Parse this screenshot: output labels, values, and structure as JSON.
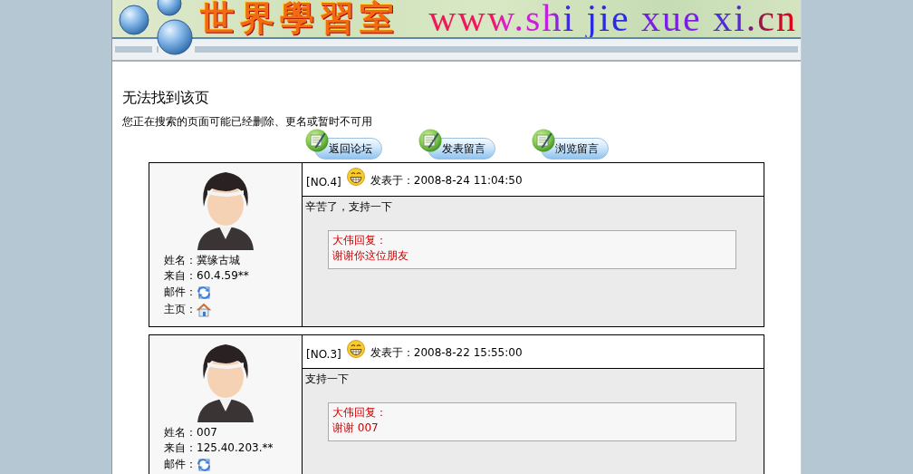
{
  "banner": {
    "title": "世界學習室",
    "url": "www.shi jie xue xi.cn"
  },
  "error": {
    "heading": "无法找到该页",
    "message": "您正在搜索的页面可能已经删除、更名或暂时不可用"
  },
  "buttons": [
    "返回论坛",
    "发表留言",
    "浏览留言"
  ],
  "posts": [
    {
      "number": "[NO.4]",
      "posted": "发表于：2008-8-24 11:04:50",
      "content": "辛苦了，支持一下",
      "reply": {
        "title": "大伟回复：",
        "text": "谢谢你这位朋友"
      },
      "author": [
        {
          "kind": "text",
          "text": "姓名：冀缘古城"
        },
        {
          "kind": "text",
          "text": "来自：60.4.59**"
        },
        {
          "kind": "email",
          "text": "邮件："
        },
        {
          "kind": "homepage",
          "text": "主页："
        }
      ]
    },
    {
      "number": "[NO.3]",
      "posted": "发表于：2008-8-22 15:55:00",
      "content": "支持一下",
      "reply": {
        "title": "大伟回复：",
        "text": "谢谢 007"
      },
      "author": [
        {
          "kind": "text",
          "text": "姓名：007"
        },
        {
          "kind": "text",
          "text": "来自：125.40.203.**"
        },
        {
          "kind": "email",
          "text": "邮件："
        }
      ]
    }
  ]
}
